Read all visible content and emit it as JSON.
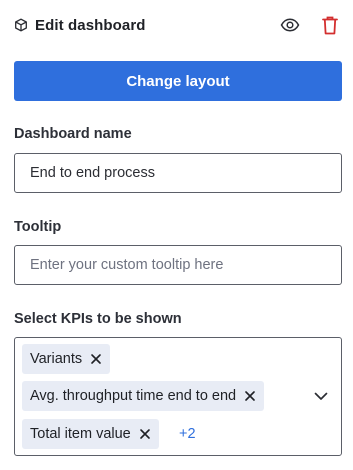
{
  "header": {
    "title": "Edit dashboard",
    "icon": "cube-icon",
    "actions": [
      "eye-icon",
      "trash-icon"
    ],
    "delete_color": "#d32f2f"
  },
  "primary_button": {
    "label": "Change layout",
    "color": "#2f6fdd"
  },
  "dashboard_name": {
    "label": "Dashboard name",
    "value": "End to end process"
  },
  "tooltip": {
    "label": "Tooltip",
    "placeholder": "Enter your custom tooltip here"
  },
  "kpis": {
    "label": "Select KPIs to be shown",
    "selected": [
      "Variants",
      "Avg. throughput time end to end",
      "Total item value"
    ],
    "more_count": "+2"
  }
}
